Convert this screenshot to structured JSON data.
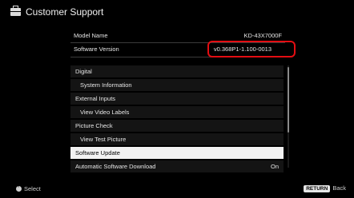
{
  "header": {
    "title": "Customer Support",
    "icon": "toolbox-icon"
  },
  "info": {
    "model_label": "Model Name",
    "model_value": "KD-43X7000F",
    "version_label": "Software Version",
    "version_value": "v0.368P1-1.100-0013"
  },
  "list": [
    {
      "label": "Digital",
      "level": 0
    },
    {
      "label": "System Information",
      "level": 1
    },
    {
      "label": "External Inputs",
      "level": 0
    },
    {
      "label": "View Video Labels",
      "level": 1
    },
    {
      "label": "Picture Check",
      "level": 0
    },
    {
      "label": "View Test Picture",
      "level": 1
    },
    {
      "label": "Software Update",
      "level": 0,
      "selected": true
    },
    {
      "label": "Automatic Software Download",
      "level": 0,
      "value": "On"
    }
  ],
  "footer": {
    "select_label": "Select",
    "return_key": "RETURN",
    "back_label": "Back"
  },
  "colors": {
    "highlight_ring": "#e30d12",
    "selected_bg": "#f2f2f2",
    "background": "#000000"
  }
}
